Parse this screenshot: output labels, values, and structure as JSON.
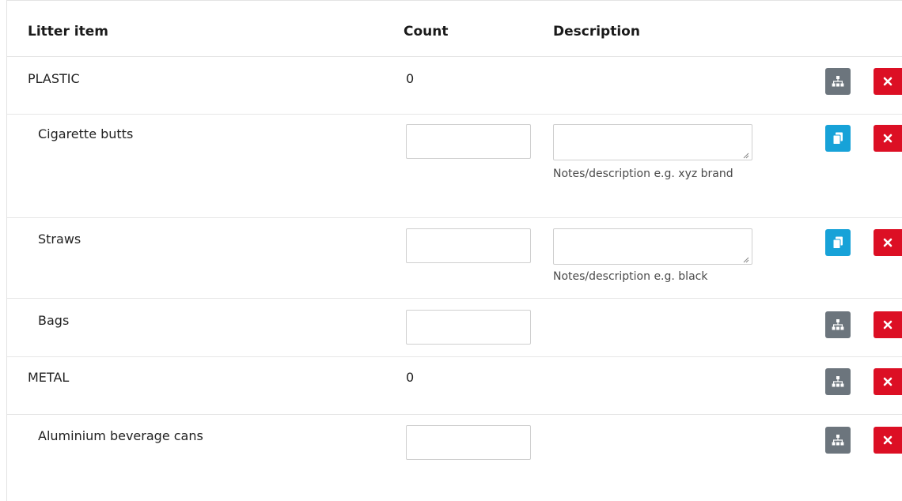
{
  "table": {
    "headers": {
      "item": "Litter item",
      "count": "Count",
      "description": "Description"
    },
    "rows": [
      {
        "label": "PLASTIC",
        "type": "category",
        "count": "0",
        "action": "hierarchy"
      },
      {
        "label": "Cigarette butts",
        "type": "item",
        "count_value": "",
        "description_value": "",
        "help": "Notes/description e.g. xyz brand",
        "action": "copy"
      },
      {
        "label": "Straws",
        "type": "item",
        "count_value": "",
        "description_value": "",
        "help": "Notes/description e.g. black",
        "action": "copy"
      },
      {
        "label": "Bags",
        "type": "item",
        "count_value": "",
        "action": "hierarchy"
      },
      {
        "label": "METAL",
        "type": "category",
        "count": "0",
        "action": "hierarchy"
      },
      {
        "label": "Aluminium beverage cans",
        "type": "item",
        "count_value": "",
        "action": "hierarchy"
      }
    ]
  },
  "icons": {
    "hierarchy": "sitemap-icon",
    "copy": "copy-icon",
    "delete": "close-icon"
  },
  "colors": {
    "grey_button": "#6c757d",
    "blue_button": "#17a2d8",
    "red_button": "#dc0f24"
  }
}
